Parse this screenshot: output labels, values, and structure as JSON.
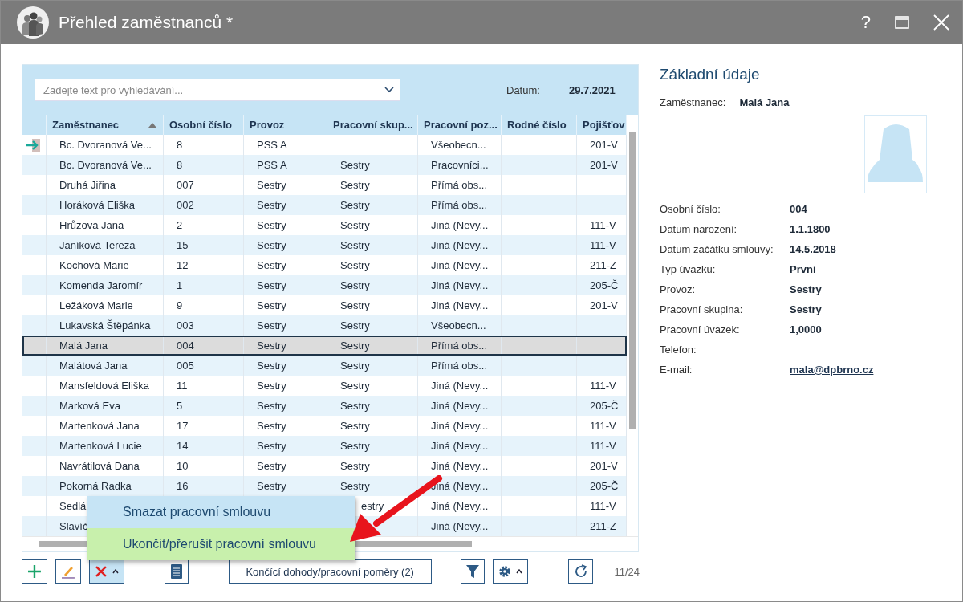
{
  "window": {
    "title": "Přehled zaměstnanců *",
    "help": "?"
  },
  "search": {
    "placeholder": "Zadejte text pro vyhledávání..."
  },
  "date": {
    "label": "Datum:",
    "value": "29.7.2021"
  },
  "table": {
    "columns": [
      {
        "label": "Zaměstnanec",
        "sorted": true
      },
      {
        "label": "Osobní číslo",
        "sorted": false
      },
      {
        "label": "Provoz",
        "sorted": false
      },
      {
        "label": "Pracovní skup...",
        "sorted": false
      },
      {
        "label": "Pracovní poz...",
        "sorted": false
      },
      {
        "label": "Rodné číslo",
        "sorted": false
      },
      {
        "label": "Pojišťov",
        "sorted": false
      }
    ],
    "rows": [
      {
        "current": true,
        "selected": false,
        "cells": {
          "name": "Bc. Dvoranová Ve...",
          "number": "8",
          "provoz": "PSS A",
          "pozice": "Všeobecn...",
          "pojistovna": "201-V"
        }
      },
      {
        "current": false,
        "selected": false,
        "cells": {
          "name": "Bc. Dvoranová Ve...",
          "number": "8",
          "provoz": "PSS A",
          "skupina": "Sestry",
          "pozice": "Pracovníci...",
          "pojistovna": "201-V"
        }
      },
      {
        "current": false,
        "selected": false,
        "cells": {
          "name": "Druhá Jiřina",
          "number": "007",
          "provoz": "Sestry",
          "skupina": "Sestry",
          "pozice": "Přímá obs..."
        }
      },
      {
        "current": false,
        "selected": false,
        "cells": {
          "name": "Horáková Eliška",
          "number": "002",
          "provoz": "Sestry",
          "skupina": "Sestry",
          "pozice": "Přímá obs..."
        }
      },
      {
        "current": false,
        "selected": false,
        "cells": {
          "name": "Hrůzová Jana",
          "number": "2",
          "provoz": "Sestry",
          "skupina": "Sestry",
          "pozice": "Jiná (Nevy...",
          "pojistovna": "111-V"
        }
      },
      {
        "current": false,
        "selected": false,
        "cells": {
          "name": "Janíková Tereza",
          "number": "15",
          "provoz": "Sestry",
          "skupina": "Sestry",
          "pozice": "Jiná (Nevy...",
          "pojistovna": "111-V"
        }
      },
      {
        "current": false,
        "selected": false,
        "cells": {
          "name": "Kochová Marie",
          "number": "12",
          "provoz": "Sestry",
          "skupina": "Sestry",
          "pozice": "Jiná (Nevy...",
          "pojistovna": "211-Z"
        }
      },
      {
        "current": false,
        "selected": false,
        "cells": {
          "name": "Komenda Jaromír",
          "number": "1",
          "provoz": "Sestry",
          "skupina": "Sestry",
          "pozice": "Jiná (Nevy...",
          "pojistovna": "205-Č"
        }
      },
      {
        "current": false,
        "selected": false,
        "cells": {
          "name": "Ležáková Marie",
          "number": "9",
          "provoz": "Sestry",
          "skupina": "Sestry",
          "pozice": "Jiná (Nevy...",
          "pojistovna": "201-V"
        }
      },
      {
        "current": false,
        "selected": false,
        "cells": {
          "name": "Lukavská Štěpánka",
          "number": "003",
          "provoz": "Sestry",
          "skupina": "Sestry",
          "pozice": "Všeobecn..."
        }
      },
      {
        "current": false,
        "selected": true,
        "cells": {
          "name": "Malá Jana",
          "number": "004",
          "provoz": "Sestry",
          "skupina": "Sestry",
          "pozice": "Přímá obs..."
        }
      },
      {
        "current": false,
        "selected": false,
        "cells": {
          "name": "Malátová Jana",
          "number": "005",
          "provoz": "Sestry",
          "skupina": "Sestry",
          "pozice": "Přímá obs..."
        }
      },
      {
        "current": false,
        "selected": false,
        "cells": {
          "name": "Mansfeldová Eliška",
          "number": "11",
          "provoz": "Sestry",
          "skupina": "Sestry",
          "pozice": "Jiná (Nevy...",
          "pojistovna": "111-V"
        }
      },
      {
        "current": false,
        "selected": false,
        "cells": {
          "name": "Marková Eva",
          "number": "5",
          "provoz": "Sestry",
          "skupina": "Sestry",
          "pozice": "Jiná (Nevy...",
          "pojistovna": "205-Č"
        }
      },
      {
        "current": false,
        "selected": false,
        "cells": {
          "name": "Martenková Jana",
          "number": "17",
          "provoz": "Sestry",
          "skupina": "Sestry",
          "pozice": "Jiná (Nevy...",
          "pojistovna": "111-V"
        }
      },
      {
        "current": false,
        "selected": false,
        "cells": {
          "name": "Martenková Lucie",
          "number": "14",
          "provoz": "Sestry",
          "skupina": "Sestry",
          "pozice": "Jiná (Nevy...",
          "pojistovna": "111-V"
        }
      },
      {
        "current": false,
        "selected": false,
        "cells": {
          "name": "Navrátilová Dana",
          "number": "10",
          "provoz": "Sestry",
          "skupina": "Sestry",
          "pozice": "Jiná (Nevy...",
          "pojistovna": "201-V"
        }
      },
      {
        "current": false,
        "selected": false,
        "cells": {
          "name": "Pokorná Radka",
          "number": "16",
          "provoz": "Sestry",
          "skupina": "Sestry",
          "pozice": "Jiná (Nevy...",
          "pojistovna": "205-Č"
        }
      },
      {
        "current": false,
        "selected": false,
        "covered": true,
        "cells": {
          "name": "Sedlá",
          "skupina": "estry",
          "pozice": "Jiná (Nevy...",
          "pojistovna": "111-V"
        }
      },
      {
        "current": false,
        "selected": false,
        "cells": {
          "name": "Slavíč",
          "pozice": "Jiná (Nevy...",
          "pojistovna": "211-Z"
        }
      }
    ]
  },
  "menu": [
    {
      "label": "Smazat pracovní smlouvu",
      "selected": false
    },
    {
      "label": "Ukončit/přerušit pracovní smlouvu",
      "selected": true
    }
  ],
  "toolbar": {
    "contracts_button": "Končící dohody/pracovní poměry (2)",
    "counter": "11/24"
  },
  "details": {
    "title": "Základní údaje",
    "employee_label": "Zaměstnanec:",
    "employee": "Malá Jana",
    "fields": [
      {
        "label": "Osobní číslo:",
        "value": "004",
        "kind": "text"
      },
      {
        "label": "Datum narození:",
        "value": "1.1.1800",
        "kind": "text"
      },
      {
        "label": "Datum začátku smlouvy:",
        "value": "14.5.2018",
        "kind": "text"
      },
      {
        "label": "Typ úvazku:",
        "value": "První",
        "kind": "text"
      },
      {
        "label": "Provoz:",
        "value": "Sestry",
        "kind": "text"
      },
      {
        "label": "Pracovní skupina:",
        "value": "Sestry",
        "kind": "text"
      },
      {
        "label": "Pracovní úvazek:",
        "value": "1,0000",
        "kind": "text"
      },
      {
        "label": "Telefon:"
      },
      {
        "label": "E-mail:",
        "value": "mala@dpbrno.cz",
        "kind": "link"
      }
    ]
  }
}
